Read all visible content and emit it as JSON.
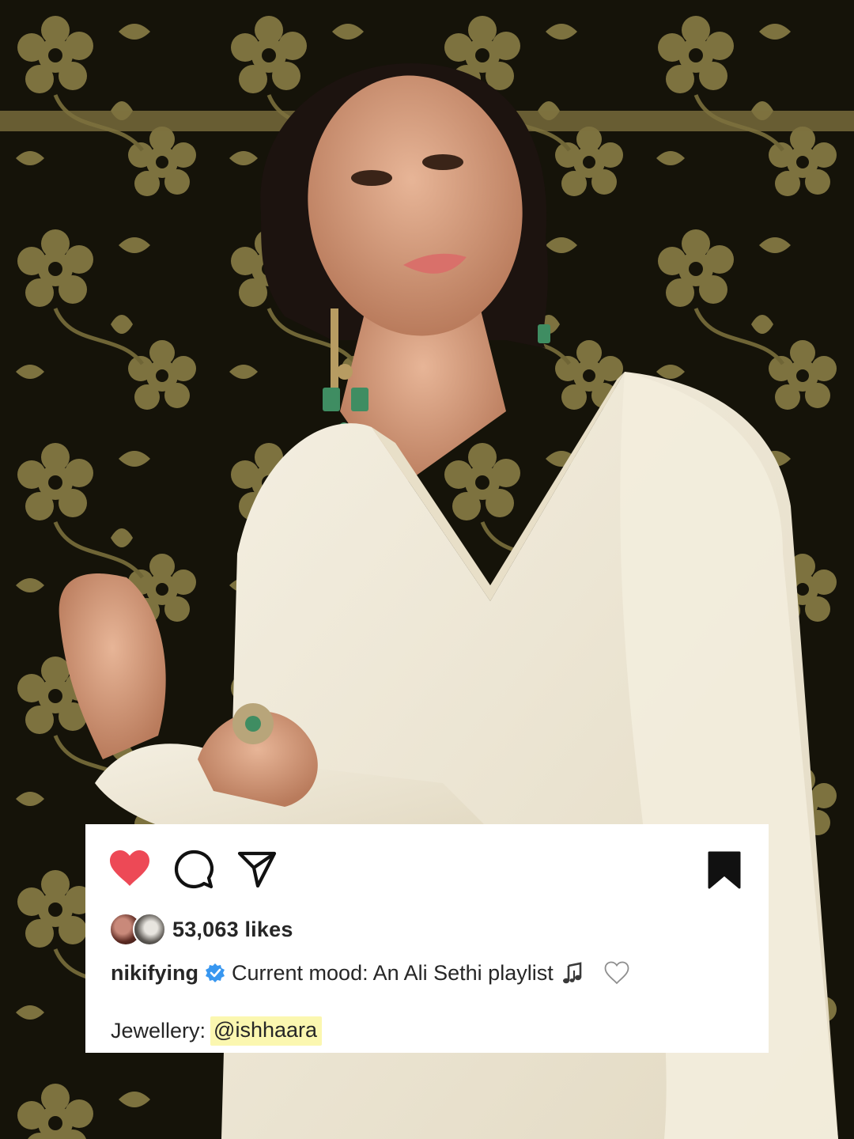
{
  "post": {
    "likes_text": "53,063 likes",
    "username": "nikifying",
    "caption": "Current mood: An Ali Sethi playlist",
    "credit_label": "Jewellery:",
    "credit_mention": "@ishhaara"
  },
  "icons": {
    "like": "heart-filled-icon",
    "comment": "comment-bubble-icon",
    "share": "paper-plane-icon",
    "save": "bookmark-filled-icon",
    "verified": "verified-badge-icon",
    "music": "music-notes-icon",
    "caption_like": "heart-outline-icon"
  },
  "colors": {
    "like_red": "#ed4956",
    "verified_blue": "#3897f0",
    "text": "#262626",
    "mention_highlight": "#fbf7b0",
    "background_gold": "#a8975a",
    "background_dark": "#151309",
    "outfit_cream": "#f1ebdb"
  }
}
